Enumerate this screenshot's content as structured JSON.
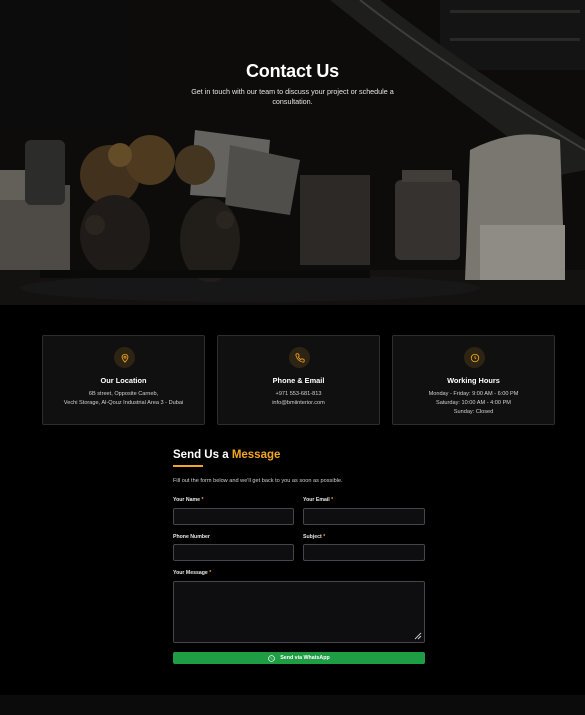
{
  "hero": {
    "title": "Contact Us",
    "subtitle": "Get in touch with our team to discuss your project or schedule a consultation."
  },
  "cards": [
    {
      "icon": "location-pin-icon",
      "title": "Our Location",
      "lines": [
        "6B street, Opposite Carneb,",
        "Vechi Storage, Al-Qouz Industrial Area 3 - Dubai"
      ]
    },
    {
      "icon": "phone-icon",
      "title": "Phone & Email",
      "lines": [
        "+971 553-681-813",
        "info@bmiinterior.com"
      ]
    },
    {
      "icon": "clock-icon",
      "title": "Working Hours",
      "lines": [
        "Monday - Friday: 9:00 AM - 6:00 PM",
        "Saturday: 10:00 AM - 4:00 PM",
        "Sunday: Closed"
      ]
    }
  ],
  "form": {
    "title_prefix": "Send Us a",
    "title_accent": "Message",
    "description": "Fill out the form below and we'll get back to you as soon as possible.",
    "required_mark": "*",
    "fields": {
      "name": {
        "label": "Your Name",
        "value": ""
      },
      "email": {
        "label": "Your Email",
        "value": ""
      },
      "phone": {
        "label": "Phone Number",
        "value": ""
      },
      "subject": {
        "label": "Subject",
        "value": ""
      },
      "message": {
        "label": "Your Message",
        "value": ""
      }
    },
    "submit_label": "Send via WhatsApp"
  },
  "colors": {
    "accent": "#f5a623",
    "whatsapp": "#1f9d45",
    "background": "#000000",
    "card": "#101010"
  }
}
